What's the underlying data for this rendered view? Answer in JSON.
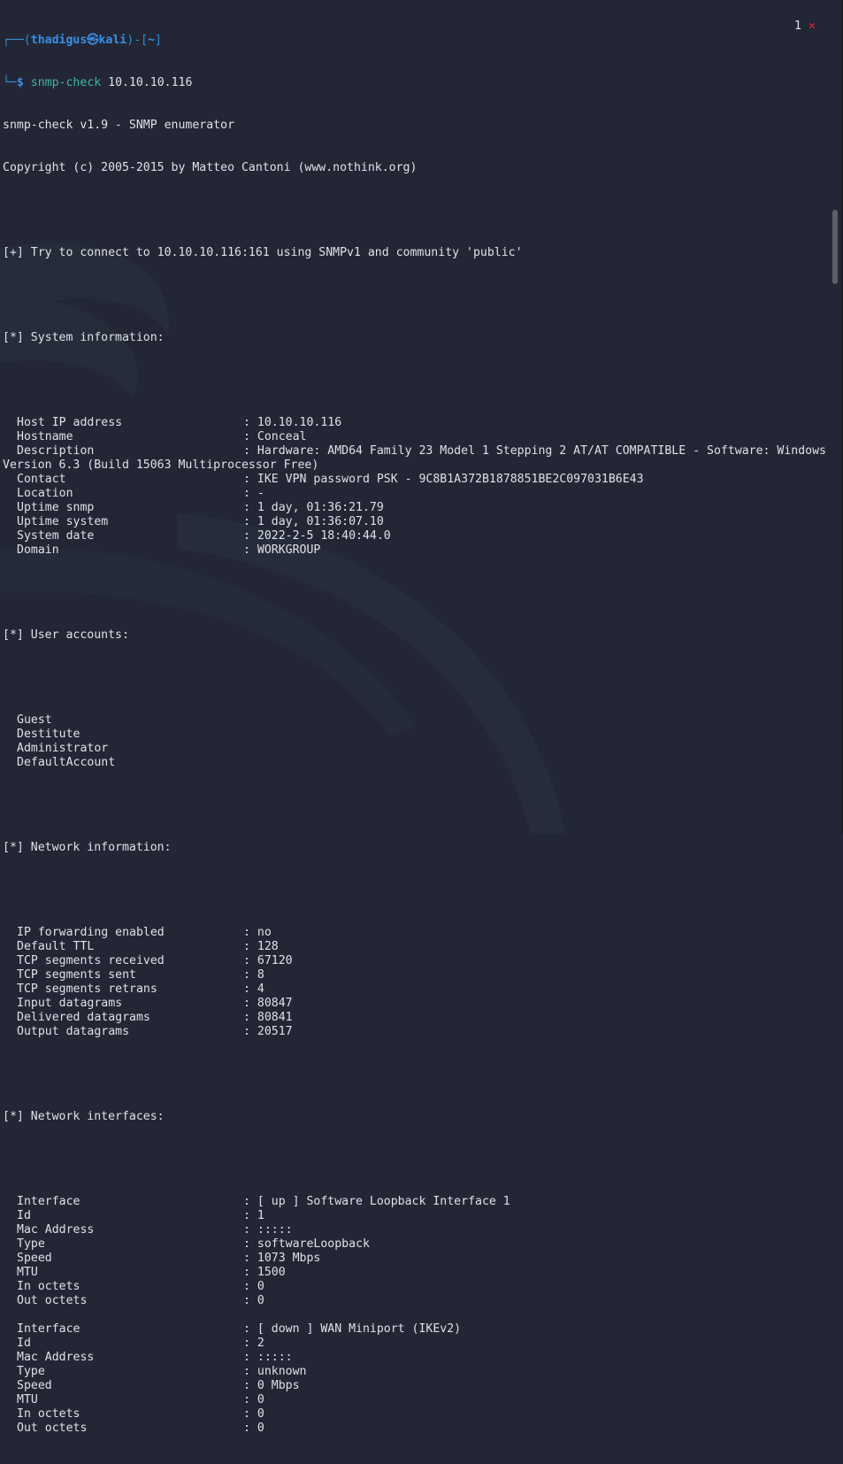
{
  "prompt": {
    "open": "┌──(",
    "user": "thadigus",
    "at": "㉿",
    "host": "kali",
    "close": ")-[",
    "cwd": "~",
    "end": "]",
    "corner": "└─",
    "dollar": "$",
    "command": "snmp-check",
    "args": " 10.10.10.116"
  },
  "tab_indicator": {
    "count": "1",
    "close_icon": "✕"
  },
  "colors": {
    "background": "#232735",
    "text": "#dfe1e6",
    "prompt_blue": "#3b8ee8",
    "command_green": "#40b3a0",
    "close_red": "#e5232d"
  },
  "header_lines": [
    "snmp-check v1.9 - SNMP enumerator",
    "Copyright (c) 2005-2015 by Matteo Cantoni (www.nothink.org)"
  ],
  "connect_line": "[+] Try to connect to 10.10.10.116:161 using SNMPv1 and community 'public'",
  "system": {
    "heading": "[*] System information:",
    "rows": [
      {
        "key": "Host IP address",
        "value": ": 10.10.10.116"
      },
      {
        "key": "Hostname",
        "value": ": Conceal"
      },
      {
        "key": "Description",
        "value": ": Hardware: AMD64 Family 23 Model 1 Stepping 2 AT/AT COMPATIBLE - Software: Windows"
      },
      {
        "wrap": "Version 6.3 (Build 15063 Multiprocessor Free)"
      },
      {
        "key": "Contact",
        "value": ": IKE VPN password PSK - 9C8B1A372B1878851BE2C097031B6E43"
      },
      {
        "key": "Location",
        "value": ": -"
      },
      {
        "key": "Uptime snmp",
        "value": ": 1 day, 01:36:21.79"
      },
      {
        "key": "Uptime system",
        "value": ": 1 day, 01:36:07.10"
      },
      {
        "key": "System date",
        "value": ": 2022-2-5 18:40:44.0"
      },
      {
        "key": "Domain",
        "value": ": WORKGROUP"
      }
    ]
  },
  "users": {
    "heading": "[*] User accounts:",
    "items": [
      "Guest",
      "Destitute",
      "Administrator",
      "DefaultAccount"
    ]
  },
  "network": {
    "heading": "[*] Network information:",
    "rows": [
      {
        "key": "IP forwarding enabled",
        "value": ": no"
      },
      {
        "key": "Default TTL",
        "value": ": 128"
      },
      {
        "key": "TCP segments received",
        "value": ": 67120"
      },
      {
        "key": "TCP segments sent",
        "value": ": 8"
      },
      {
        "key": "TCP segments retrans",
        "value": ": 4"
      },
      {
        "key": "Input datagrams",
        "value": ": 80847"
      },
      {
        "key": "Delivered datagrams",
        "value": ": 80841"
      },
      {
        "key": "Output datagrams",
        "value": ": 20517"
      }
    ]
  },
  "interfaces": {
    "heading": "[*] Network interfaces:",
    "blocks": [
      [
        {
          "key": "Interface",
          "value": ": [ up ] Software Loopback Interface 1"
        },
        {
          "key": "Id",
          "value": ": 1"
        },
        {
          "key": "Mac Address",
          "value": ": :::::"
        },
        {
          "key": "Type",
          "value": ": softwareLoopback"
        },
        {
          "key": "Speed",
          "value": ": 1073 Mbps"
        },
        {
          "key": "MTU",
          "value": ": 1500"
        },
        {
          "key": "In octets",
          "value": ": 0"
        },
        {
          "key": "Out octets",
          "value": ": 0"
        }
      ],
      [
        {
          "key": "Interface",
          "value": ": [ down ] WAN Miniport (IKEv2)"
        },
        {
          "key": "Id",
          "value": ": 2"
        },
        {
          "key": "Mac Address",
          "value": ": :::::"
        },
        {
          "key": "Type",
          "value": ": unknown"
        },
        {
          "key": "Speed",
          "value": ": 0 Mbps"
        },
        {
          "key": "MTU",
          "value": ": 0"
        },
        {
          "key": "In octets",
          "value": ": 0"
        },
        {
          "key": "Out octets",
          "value": ": 0"
        }
      ]
    ]
  }
}
